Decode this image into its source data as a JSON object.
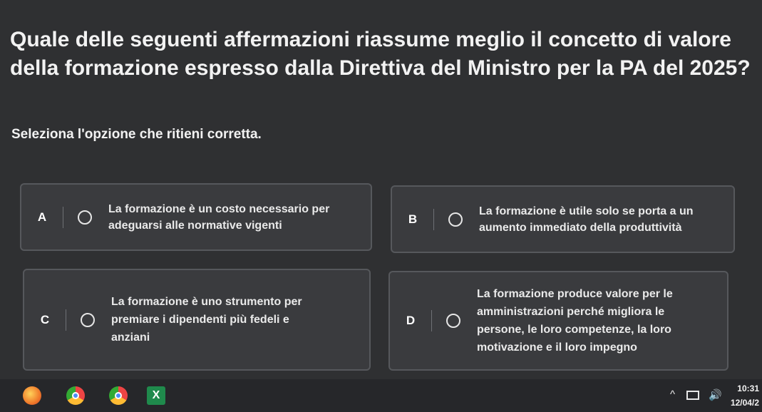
{
  "question": "Quale delle seguenti affermazioni riassume meglio il concetto di valore della formazione espresso dalla Direttiva del Ministro per la PA del 2025?",
  "instruction": "Seleziona l'opzione che ritieni corretta.",
  "options": [
    {
      "letter": "A",
      "text": "La formazione è un costo necessario per adeguarsi alle normative vigenti"
    },
    {
      "letter": "B",
      "text": "La formazione è utile solo se porta a un aumento immediato della produttività"
    },
    {
      "letter": "C",
      "text": "La formazione è uno strumento per premiare i dipendenti più fedeli e anziani"
    },
    {
      "letter": "D",
      "text": "La formazione produce valore per le amministrazioni perché migliora le persone, le loro competenze, la loro motivazione e il loro impegno"
    }
  ],
  "taskbar": {
    "apps": [
      "firefox-icon",
      "chrome-icon",
      "chrome-icon",
      "excel-icon"
    ],
    "excel_glyph": "X",
    "tray_chevron": "^",
    "volume_glyph": "🔊",
    "time": "10:31",
    "date": "12/04/2"
  }
}
